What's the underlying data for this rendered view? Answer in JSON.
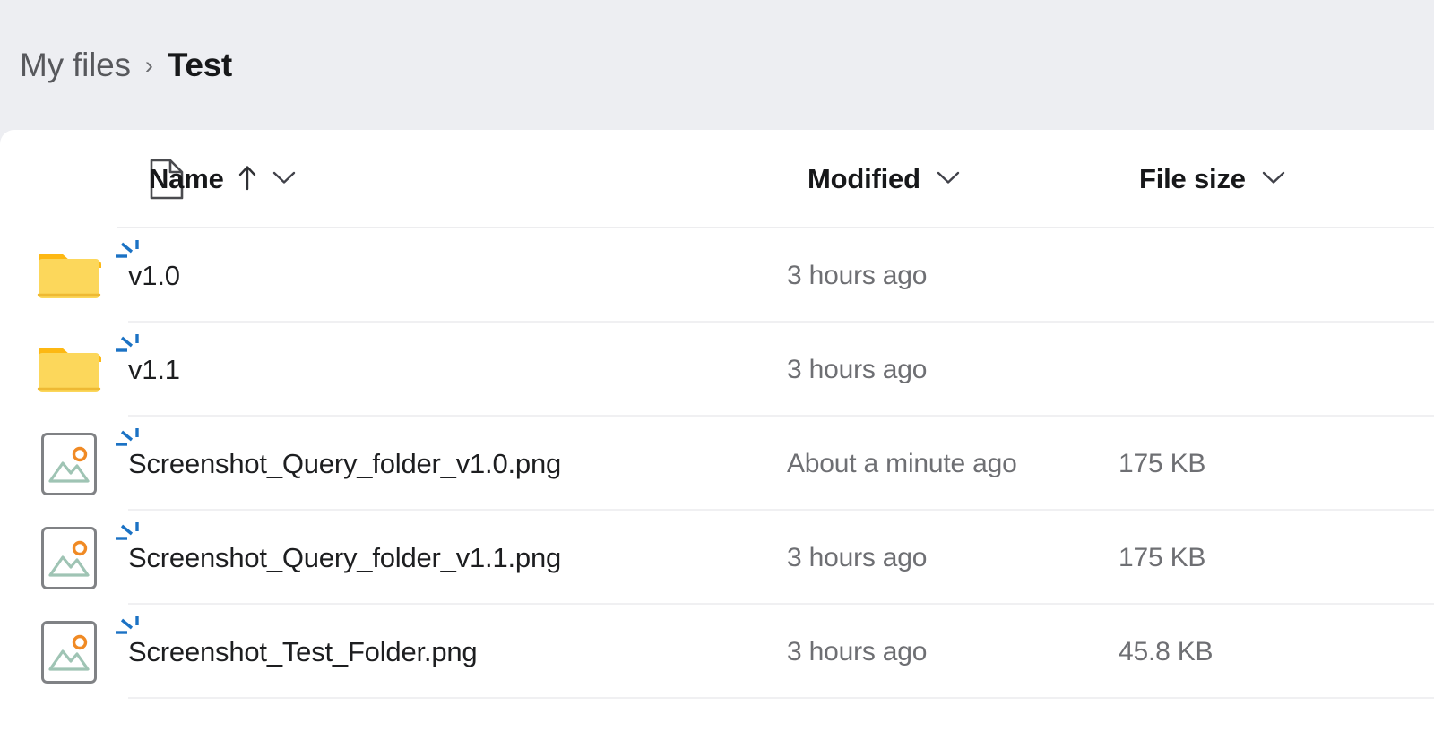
{
  "breadcrumb": {
    "root_label": "My files",
    "separator": "›",
    "current_label": "Test"
  },
  "columns": {
    "type_icon_name": "file-type-icon",
    "name_label": "Name",
    "name_sort_arrow": "↑",
    "name_chevron": "⌄",
    "modified_label": "Modified",
    "modified_chevron": "⌄",
    "size_label": "File size",
    "size_chevron": "⌄"
  },
  "colors": {
    "page_background": "#edeef2",
    "card_background": "#ffffff",
    "folder_body": "#fcd75b",
    "folder_tab": "#fdb813",
    "image_frame": "#808285",
    "image_sun": "#f08a24",
    "image_mountain": "#9fc4b4",
    "marker_blue": "#1b72c4",
    "divider": "#f0f0f2",
    "primary_text": "#1d1e20",
    "secondary_text": "#6e6f73"
  },
  "rows": [
    {
      "icon": "folder-icon",
      "name": "v1.0",
      "modified": "3 hours ago",
      "size": "",
      "marker": "click-burst-marker"
    },
    {
      "icon": "folder-icon",
      "name": "v1.1",
      "modified": "3 hours ago",
      "size": "",
      "marker": "click-burst-marker"
    },
    {
      "icon": "image-file-icon",
      "name": "Screenshot_Query_folder_v1.0.png",
      "modified": "About a minute ago",
      "size": "175 KB",
      "marker": "click-burst-marker"
    },
    {
      "icon": "image-file-icon",
      "name": "Screenshot_Query_folder_v1.1.png",
      "modified": "3 hours ago",
      "size": "175 KB",
      "marker": "click-burst-marker"
    },
    {
      "icon": "image-file-icon",
      "name": "Screenshot_Test_Folder.png",
      "modified": "3 hours ago",
      "size": "45.8 KB",
      "marker": "click-burst-marker"
    }
  ]
}
